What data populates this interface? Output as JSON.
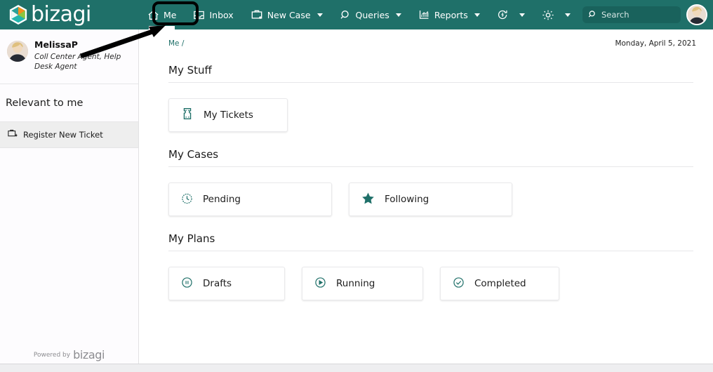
{
  "brand": {
    "name": "bizagi",
    "accent": "#1f7069",
    "logo_icon": "bizagi-hexagon-logo"
  },
  "topnav": {
    "items": [
      {
        "label": "Me",
        "icon": "home-icon",
        "caret": false,
        "active": true,
        "highlighted": true
      },
      {
        "label": "Inbox",
        "icon": "inbox-icon",
        "caret": false,
        "active": false,
        "highlighted": false
      },
      {
        "label": "New Case",
        "icon": "briefcase-plus-icon",
        "caret": true,
        "active": false,
        "highlighted": false
      },
      {
        "label": "Queries",
        "icon": "search-icon",
        "caret": true,
        "active": false,
        "highlighted": false
      },
      {
        "label": "Reports",
        "icon": "bar-chart-icon",
        "caret": true,
        "active": false,
        "highlighted": false
      },
      {
        "label": "",
        "icon": "sync-bolt-icon",
        "caret": true,
        "active": false,
        "highlighted": false
      },
      {
        "label": "",
        "icon": "gear-icon",
        "caret": true,
        "active": false,
        "highlighted": false
      }
    ],
    "search": {
      "placeholder": "Search",
      "value": "",
      "icon": "search-icon"
    },
    "avatar": {
      "icon": "user-avatar",
      "alt": "MelissaP"
    }
  },
  "sidebar": {
    "user": {
      "name": "MelissaP",
      "roles": "Coll Center Agent, Help Desk Agent",
      "avatar_icon": "user-avatar"
    },
    "section_title": "Relevant to me",
    "links": [
      {
        "label": "Register New Ticket",
        "icon": "briefcase-down-icon",
        "selected": true
      }
    ],
    "footer": {
      "powered_by": "Powered by",
      "brand": "bizagi"
    }
  },
  "main": {
    "breadcrumb": "Me /",
    "date": "Monday, April 5, 2021",
    "sections": [
      {
        "title": "My Stuff",
        "cards": [
          {
            "label": "My Tickets",
            "icon": "ticket-icon",
            "width": "w170"
          }
        ]
      },
      {
        "title": "My Cases",
        "cards": [
          {
            "label": "Pending",
            "icon": "clock-icon",
            "width": "w233"
          },
          {
            "label": "Following",
            "icon": "star-icon",
            "width": "w233"
          }
        ]
      },
      {
        "title": "My Plans",
        "cards": [
          {
            "label": "Drafts",
            "icon": "pause-circle-icon",
            "width": "w170"
          },
          {
            "label": "Running",
            "icon": "play-circle-icon",
            "width": "w173"
          },
          {
            "label": "Completed",
            "icon": "check-circle-icon",
            "width": "w170"
          }
        ]
      }
    ]
  },
  "annotation": {
    "type": "arrow",
    "target": "Me",
    "highlight_color": "#000000"
  }
}
